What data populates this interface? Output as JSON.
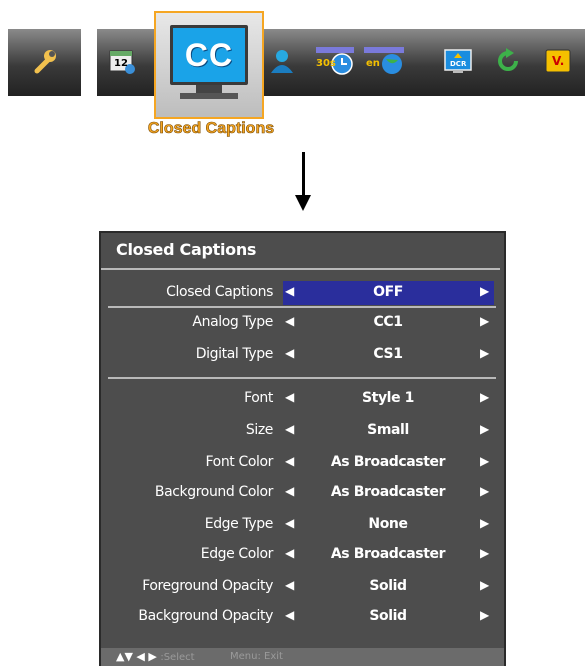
{
  "toolbar": {
    "selected_icon_text": "CC",
    "selected_label": "Closed Captions",
    "calendar_day": "12",
    "timer_text": "30s",
    "lang_text": "en",
    "dcr_text": "DCR",
    "v_text": "V."
  },
  "panel": {
    "title": "Closed Captions",
    "rows": [
      {
        "label": "Closed Captions",
        "value": "OFF"
      },
      {
        "label": "Analog Type",
        "value": "CC1"
      },
      {
        "label": "Digital Type",
        "value": "CS1"
      },
      {
        "label": "Font",
        "value": "Style 1"
      },
      {
        "label": "Size",
        "value": "Small"
      },
      {
        "label": "Font Color",
        "value": "As Broadcaster"
      },
      {
        "label": "Background Color",
        "value": "As Broadcaster"
      },
      {
        "label": "Edge Type",
        "value": "None"
      },
      {
        "label": "Edge Color",
        "value": "As Broadcaster"
      },
      {
        "label": "Foreground Opacity",
        "value": "Solid"
      },
      {
        "label": "Background Opacity",
        "value": "Solid"
      }
    ],
    "footer_nav_arrows": "▲▼ ◀ ▶",
    "footer_select": ":Select",
    "footer_exit": "Menu: Exit"
  },
  "colors": {
    "accent": "#f5a623",
    "highlight": "#2a2e9c",
    "panel_bg": "#4d4d4d"
  }
}
